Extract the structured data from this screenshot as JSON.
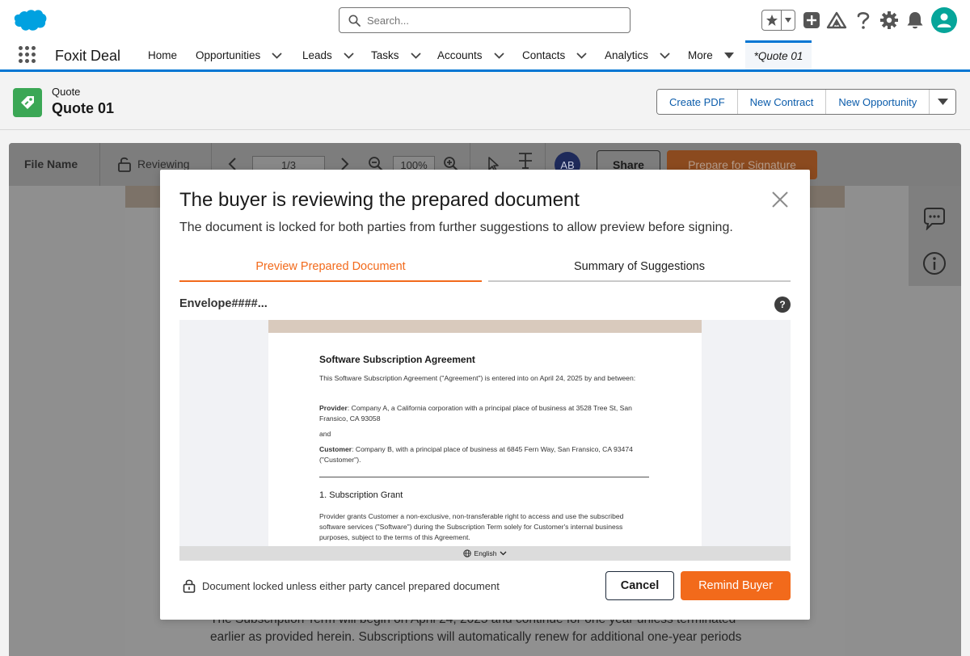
{
  "global_header": {
    "logo": "salesforce-cloud-logo",
    "search": {
      "placeholder": "Search..."
    },
    "icons": [
      "favorites-star-icon",
      "global-add-icon",
      "trailhead-guidance-icon",
      "help-icon",
      "setup-gear-icon",
      "notifications-bell-icon",
      "user-avatar-icon"
    ]
  },
  "nav": {
    "app_name": "Foxit Deal",
    "items": [
      {
        "label": "Home",
        "has_menu": false
      },
      {
        "label": "Opportunities",
        "has_menu": true
      },
      {
        "label": "Leads",
        "has_menu": true
      },
      {
        "label": "Tasks",
        "has_menu": true
      },
      {
        "label": "Accounts",
        "has_menu": true
      },
      {
        "label": "Contacts",
        "has_menu": true
      },
      {
        "label": "Analytics",
        "has_menu": true
      },
      {
        "label": "More",
        "has_menu": true
      }
    ],
    "active_tab": "*Quote 01"
  },
  "record": {
    "type": "Quote",
    "name": "Quote 01",
    "actions": [
      "Create PDF",
      "New Contract",
      "New Opportunity"
    ]
  },
  "viewer": {
    "file_name": "File Name",
    "status": "Reviewing",
    "page": "1/3",
    "zoom": "100%",
    "avatar_initials": "AB",
    "share_label": "Share",
    "prepare_label": "Prepare for Signature",
    "bg_lines": [
      "The Subscription Term will begin on April 24, 2025 and continue for one year unless terminated",
      "earlier as provided herein. Subscriptions will automatically renew for additional one-year periods"
    ]
  },
  "modal": {
    "title": "The buyer is reviewing the prepared document",
    "subtitle": "The document is locked for both parties from further suggestions to allow preview before signing.",
    "tabs": [
      "Preview Prepared Document",
      "Summary of Suggestions"
    ],
    "active_tab_index": 0,
    "envelope": "Envelope####...",
    "help": "?",
    "preview": {
      "title": "Software Subscription Agreement",
      "intro": "This Software Subscription Agreement (\"Agreement\") is entered into on April 24, 2025 by and between:",
      "provider_label": "Provider",
      "provider_text": ": Company A, a California corporation with a principal place of business at 3528 Tree St, San Fransico, CA 93058",
      "and": "and",
      "customer_label": "Customer",
      "customer_text": ": Company B, with a principal place of business at 6845 Fern Way, San Fransico, CA 93474 (\"Customer\").",
      "section_heading": "1. Subscription Grant",
      "section_text": "Provider grants Customer a non-exclusive, non-transferable right to access and use the subscribed software services (\"Software\") during the Subscription Term solely for Customer's internal business purposes, subject to the terms of this Agreement.",
      "language": "English"
    },
    "lock_note": "Document locked unless either party cancel prepared document",
    "cancel_label": "Cancel",
    "remind_label": "Remind Buyer",
    "accent_color": "#f26a1b"
  }
}
